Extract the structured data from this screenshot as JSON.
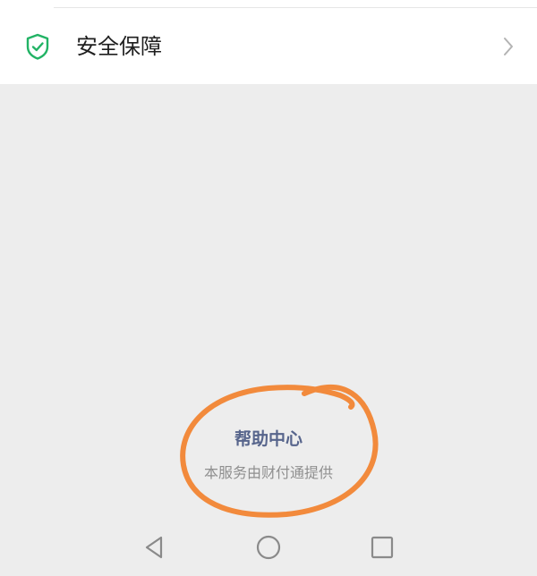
{
  "settings_row": {
    "label": "安全保障",
    "icon": "shield-check-icon",
    "icon_color": "#22b365"
  },
  "footer": {
    "help_title": "帮助中心",
    "provider_note": "本服务由财付通提供"
  },
  "annotation": {
    "color": "#f28a3c"
  },
  "navbar": {
    "buttons": [
      "back-icon",
      "home-icon",
      "recents-icon"
    ]
  }
}
